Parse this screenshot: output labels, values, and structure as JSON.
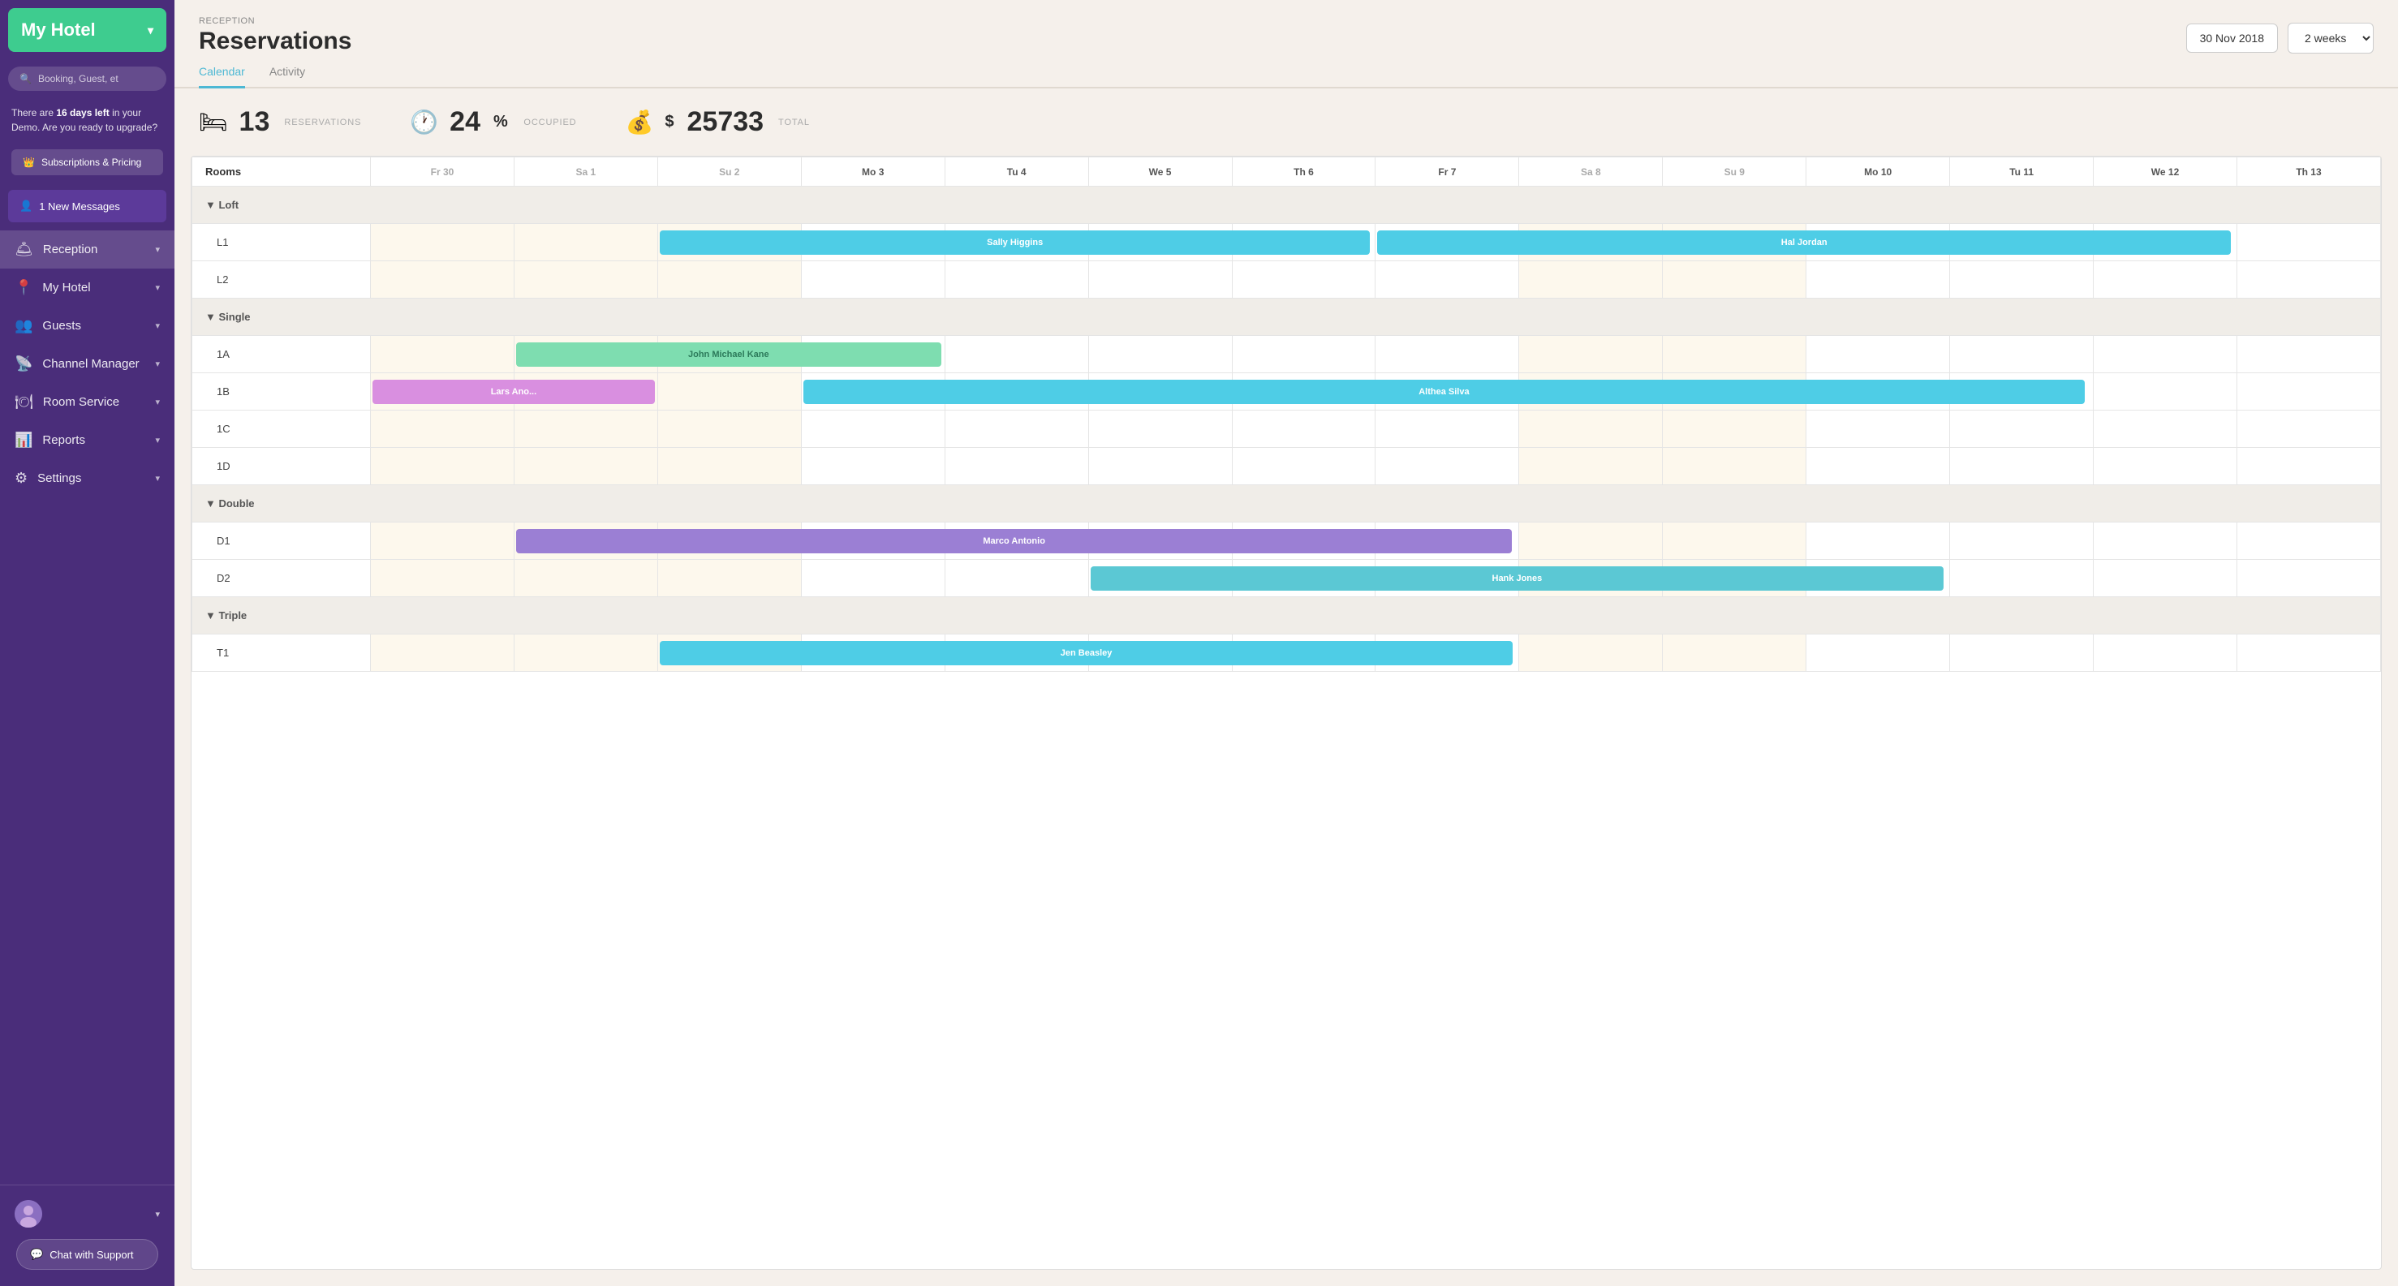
{
  "sidebar": {
    "hotel_name": "My Hotel",
    "search_placeholder": "Booking, Guest, et",
    "demo_notice": "There are ",
    "demo_days": "16 days left",
    "demo_notice2": " in your Demo. Are you ready to upgrade?",
    "upgrade_label": "Subscriptions & Pricing",
    "messages_label": "1 New Messages",
    "nav_items": [
      {
        "id": "reception",
        "label": "Reception",
        "icon": "🛎"
      },
      {
        "id": "my-hotel",
        "label": "My Hotel",
        "icon": "📍"
      },
      {
        "id": "guests",
        "label": "Guests",
        "icon": "👥"
      },
      {
        "id": "channel-manager",
        "label": "Channel Manager",
        "icon": "📡"
      },
      {
        "id": "room-service",
        "label": "Room Service",
        "icon": "🍽"
      },
      {
        "id": "reports",
        "label": "Reports",
        "icon": "📊"
      },
      {
        "id": "settings",
        "label": "Settings",
        "icon": "⚙"
      }
    ],
    "chat_support_label": "Chat with Support"
  },
  "header": {
    "breadcrumb": "RECEPTION",
    "title": "Reservations",
    "date": "30 Nov 2018",
    "view": "2 weeks"
  },
  "tabs": [
    {
      "id": "calendar",
      "label": "Calendar",
      "active": true
    },
    {
      "id": "activity",
      "label": "Activity",
      "active": false
    }
  ],
  "stats": {
    "reservations": {
      "count": "13",
      "label": "RESERVATIONS"
    },
    "occupied": {
      "percent": "24",
      "symbol": "%",
      "label": "OCCUPIED"
    },
    "total": {
      "currency": "$",
      "amount": "25733",
      "label": "TOTAL"
    }
  },
  "calendar": {
    "rooms_col_header": "Rooms",
    "day_headers": [
      {
        "label": "Fr 30",
        "weekend": true
      },
      {
        "label": "Sa 1",
        "weekend": true
      },
      {
        "label": "Su 2",
        "weekend": true
      },
      {
        "label": "Mo 3",
        "weekend": false
      },
      {
        "label": "Tu 4",
        "weekend": false
      },
      {
        "label": "We 5",
        "weekend": false
      },
      {
        "label": "Th 6",
        "weekend": false
      },
      {
        "label": "Fr 7",
        "weekend": false
      },
      {
        "label": "Sa 8",
        "weekend": true
      },
      {
        "label": "Su 9",
        "weekend": true
      },
      {
        "label": "Mo 10",
        "weekend": false
      },
      {
        "label": "Tu 11",
        "weekend": false
      },
      {
        "label": "We 12",
        "weekend": false
      },
      {
        "label": "Th 13",
        "weekend": false
      }
    ],
    "sections": [
      {
        "name": "Loft",
        "rooms": [
          {
            "id": "L1",
            "bookings": [
              {
                "guest": "Sally Higgins",
                "startCol": 3,
                "span": 5,
                "color": "booking-cyan",
                "offset": 0
              },
              {
                "guest": "Hal Jordan",
                "startCol": 8,
                "span": 6,
                "color": "booking-cyan",
                "offset": 0
              }
            ]
          },
          {
            "id": "L2",
            "bookings": []
          }
        ]
      },
      {
        "name": "Single",
        "rooms": [
          {
            "id": "1A",
            "bookings": [
              {
                "guest": "John Michael Kane",
                "startCol": 2,
                "span": 3,
                "color": "booking-green",
                "offset": 0
              }
            ]
          },
          {
            "id": "1B",
            "bookings": [
              {
                "guest": "Lars Ano...",
                "startCol": 1,
                "span": 2,
                "color": "booking-pink",
                "offset": 0
              },
              {
                "guest": "Althea Silva",
                "startCol": 4,
                "span": 9,
                "color": "booking-cyan",
                "offset": 0
              }
            ]
          },
          {
            "id": "1C",
            "bookings": []
          },
          {
            "id": "1D",
            "bookings": []
          }
        ]
      },
      {
        "name": "Double",
        "rooms": [
          {
            "id": "D1",
            "bookings": [
              {
                "guest": "Marco Antonio",
                "startCol": 2,
                "span": 7,
                "color": "booking-purple",
                "offset": 0
              }
            ]
          },
          {
            "id": "D2",
            "bookings": [
              {
                "guest": "Hank Jones",
                "startCol": 6,
                "span": 6,
                "color": "booking-teal",
                "offset": 0
              }
            ]
          }
        ]
      },
      {
        "name": "Triple",
        "rooms": [
          {
            "id": "T1",
            "bookings": [
              {
                "guest": "Jen Beasley",
                "startCol": 3,
                "span": 6,
                "color": "booking-cyan",
                "offset": 0
              }
            ]
          }
        ]
      }
    ]
  }
}
